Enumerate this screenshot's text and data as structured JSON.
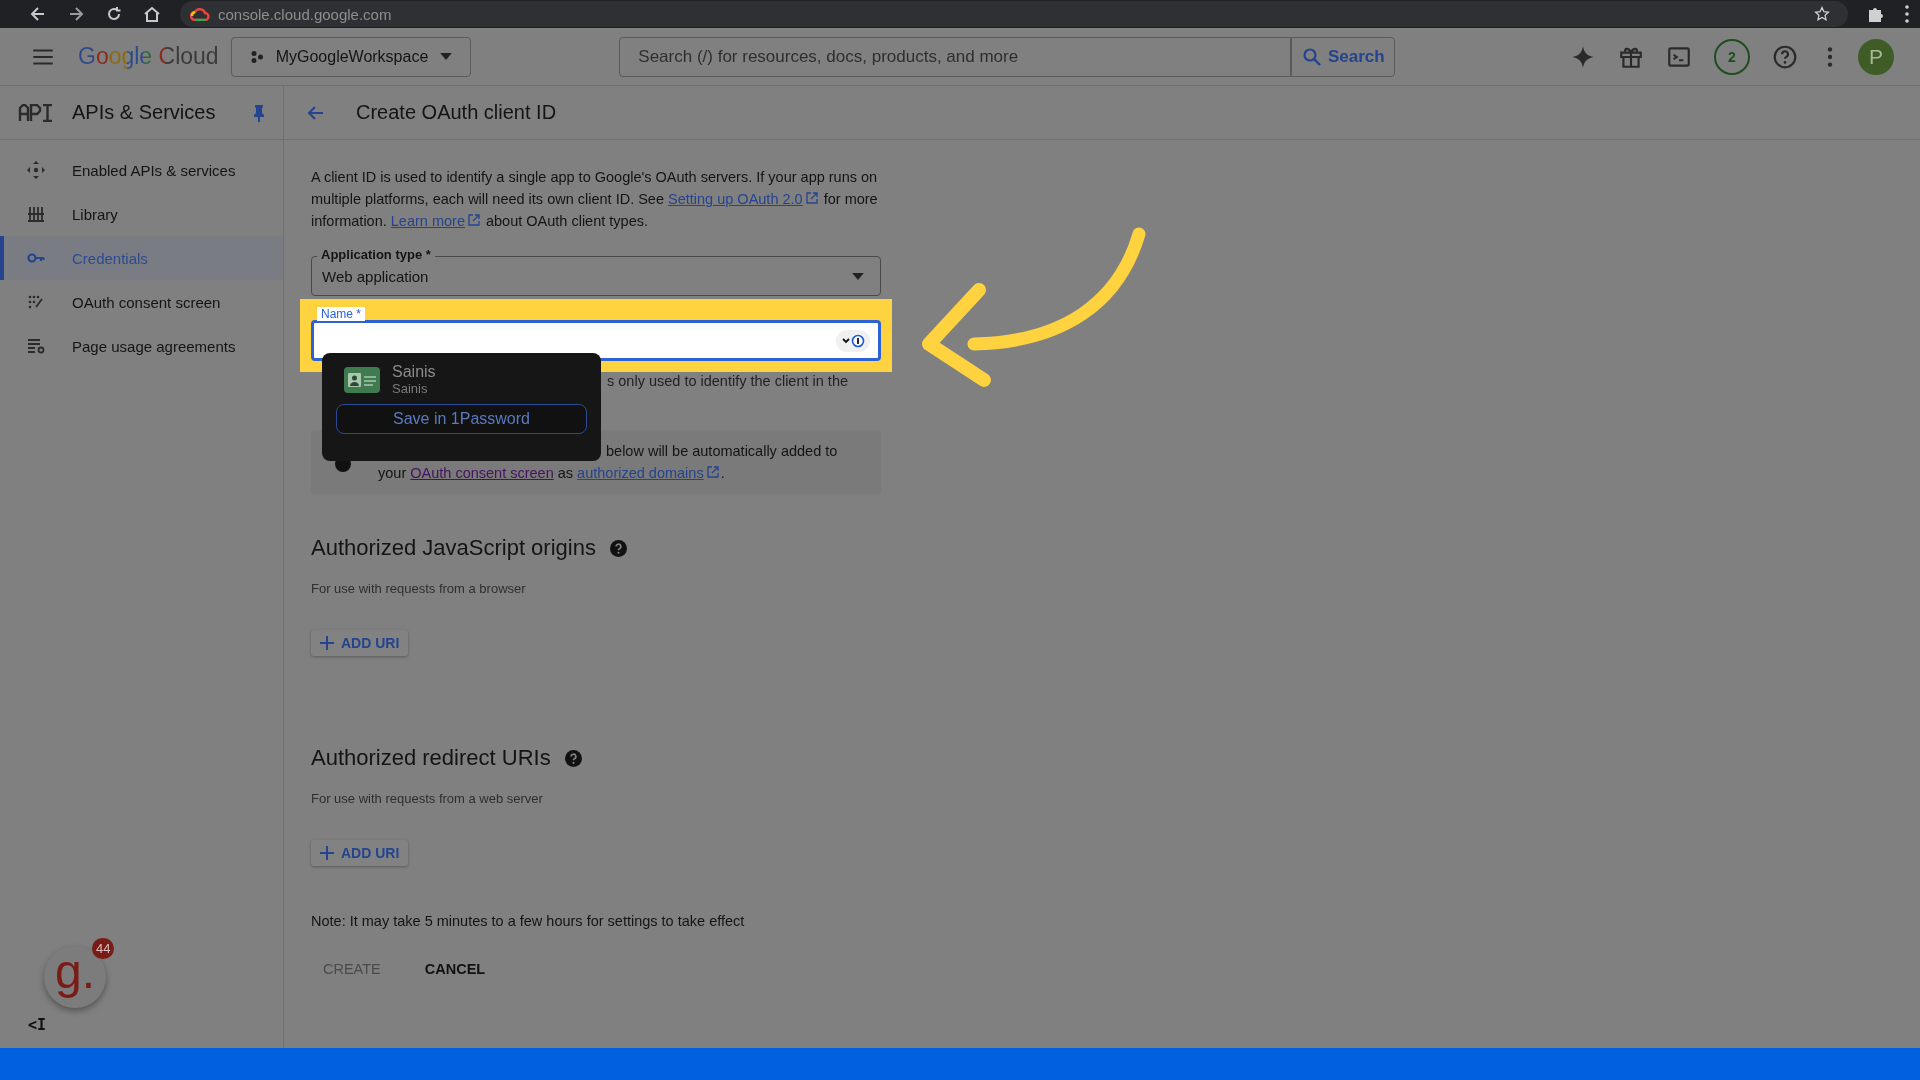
{
  "browser": {
    "url": "console.cloud.google.com"
  },
  "header": {
    "logo": "Google Cloud",
    "project": "MyGoogleWorkspace",
    "search_placeholder": "Search (/) for resources, docs, products, and more",
    "search_button": "Search",
    "notifications": "2",
    "avatar": "P"
  },
  "sidebar": {
    "title": "APIs & Services",
    "items": [
      {
        "label": "Enabled APIs & services",
        "selected": false
      },
      {
        "label": "Library",
        "selected": false
      },
      {
        "label": "Credentials",
        "selected": true
      },
      {
        "label": "OAuth consent screen",
        "selected": false
      },
      {
        "label": "Page usage agreements",
        "selected": false
      }
    ],
    "collapse": "<I"
  },
  "page": {
    "title": "Create OAuth client ID"
  },
  "description": [
    {
      "kind": "text",
      "text": "A client ID is used to identify a single app to Google's OAuth servers. If your app runs on multiple platforms, each will need its own client ID. See "
    },
    {
      "kind": "link",
      "text": "Setting up OAuth 2.0"
    },
    {
      "kind": "text",
      "text": " for more information. "
    },
    {
      "kind": "link",
      "text": "Learn more"
    },
    {
      "kind": "text",
      "text": " about OAuth client types."
    }
  ],
  "app_type": {
    "label": "Application type *",
    "value": "Web application"
  },
  "name_field": {
    "label": "Name *",
    "highlighted": true
  },
  "hint": "s only used to identify the client in the",
  "autofill": {
    "title": "Sainis",
    "subtitle": "Sainis",
    "button": "Save in 1Password"
  },
  "info_box": {
    "line_1": "below will be automatically added to",
    "line_2": [
      {
        "kind": "text",
        "text": "your "
      },
      {
        "kind": "visited",
        "text": "OAuth consent screen"
      },
      {
        "kind": "text",
        "text": " as "
      },
      {
        "kind": "link",
        "text": "authorized domains"
      },
      {
        "kind": "text",
        "text": "."
      }
    ]
  },
  "sections": [
    {
      "title": "Authorized JavaScript origins",
      "subtitle": "For use with requests from a browser",
      "button": "ADD URI"
    },
    {
      "title": "Authorized redirect URIs",
      "subtitle": "For use with requests from a web server",
      "button": "ADD URI"
    }
  ],
  "note": "Note: It may take 5 minutes to a few hours for settings to take effect",
  "actions": [
    {
      "label": "CREATE",
      "disabled": true
    },
    {
      "label": "CANCEL",
      "disabled": false
    }
  ],
  "floating_app": {
    "letter": "g.",
    "badge": "44"
  }
}
